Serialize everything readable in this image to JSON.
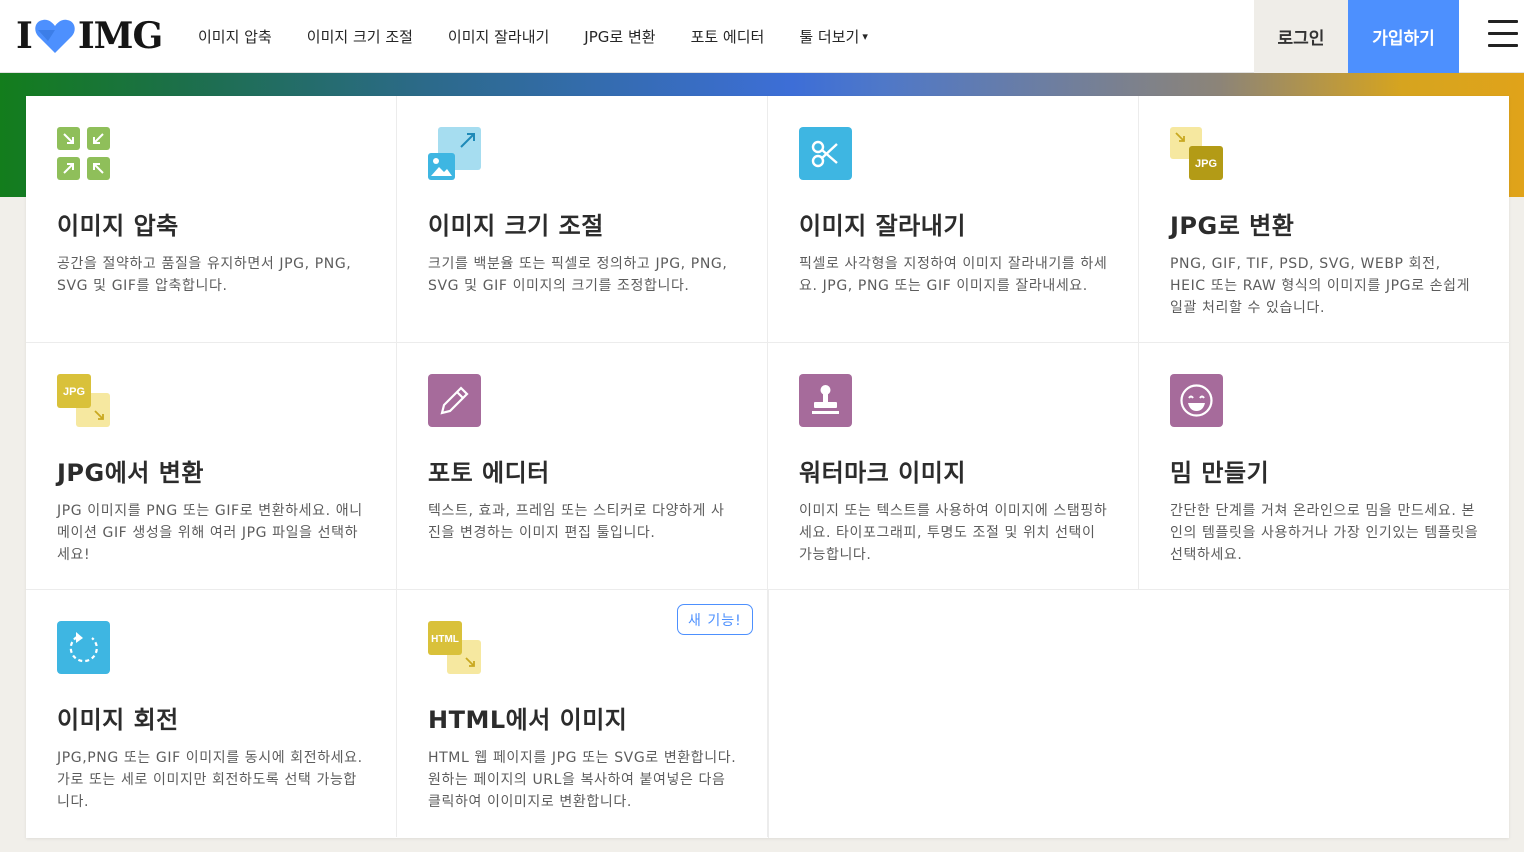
{
  "header": {
    "logo_left": "I",
    "logo_right": "IMG",
    "nav": [
      {
        "label": "이미지 압축"
      },
      {
        "label": "이미지 크기 조절"
      },
      {
        "label": "이미지 잘라내기"
      },
      {
        "label": "JPG로 변환"
      },
      {
        "label": "포토 에디터"
      },
      {
        "label": "툴 더보기",
        "caret": "▾"
      }
    ],
    "login": "로그인",
    "signup": "가입하기"
  },
  "colors": {
    "accent": "#4d90fe",
    "green": "#8fbf5a",
    "blue": "#3eb6e2",
    "yellow": "#d9c13a",
    "purple": "#a66b9b"
  },
  "tools": [
    {
      "title": "이미지 압축",
      "desc": "공간을 절약하고 품질을 유지하면서 JPG, PNG, SVG 및 GIF를 압축합니다.",
      "icon": "compress-icon"
    },
    {
      "title": "이미지 크기 조절",
      "desc": "크기를 백분율 또는 픽셀로 정의하고 JPG, PNG, SVG 및 GIF 이미지의 크기를 조정합니다.",
      "icon": "resize-icon"
    },
    {
      "title": "이미지 잘라내기",
      "desc": "픽셀로 사각형을 지정하여 이미지 잘라내기를 하세요. JPG, PNG 또는 GIF 이미지를 잘라내세요.",
      "icon": "crop-icon"
    },
    {
      "title": "JPG로 변환",
      "desc": "PNG, GIF, TIF, PSD, SVG, WEBP 회전, HEIC 또는 RAW 형식의 이미지를 JPG로 손쉽게 일괄 처리할 수 있습니다.",
      "icon": "convert-to-jpg-icon",
      "icon_text": "JPG"
    },
    {
      "title": "JPG에서 변환",
      "desc": "JPG 이미지를 PNG 또는 GIF로 변환하세요. 애니메이션 GIF 생성을 위해 여러 JPG 파일을 선택하세요!",
      "icon": "convert-from-jpg-icon",
      "icon_text": "JPG"
    },
    {
      "title": "포토 에디터",
      "desc": "텍스트, 효과, 프레임 또는 스티커로 다양하게 사진을 변경하는 이미지 편집 툴입니다.",
      "icon": "pencil-icon"
    },
    {
      "title": "워터마크 이미지",
      "desc": "이미지 또는 텍스트를 사용하여 이미지에 스탬핑하세요. 타이포그래피, 투명도 조절 및 위치 선택이 가능합니다.",
      "icon": "stamp-icon"
    },
    {
      "title": "밈 만들기",
      "desc": "간단한 단계를 거쳐 온라인으로 밈을 만드세요. 본인의 템플릿을 사용하거나 가장 인기있는 템플릿을 선택하세요.",
      "icon": "meme-face-icon"
    },
    {
      "title": "이미지 회전",
      "desc": "JPG,PNG 또는 GIF 이미지를 동시에 회전하세요. 가로 또는 세로 이미지만 회전하도록 선택 가능합니다.",
      "icon": "rotate-icon"
    },
    {
      "title": "HTML에서 이미지",
      "desc": "HTML 웹 페이지를 JPG 또는 SVG로 변환합니다. 원하는 페이지의 URL을 복사하여 붙여넣은 다음 클릭하여 이이미지로 변환합니다.",
      "icon": "html-to-image-icon",
      "icon_text": "HTML",
      "badge": "새 기능!"
    }
  ]
}
